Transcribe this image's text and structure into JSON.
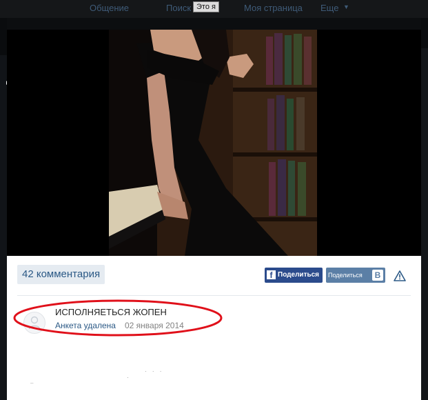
{
  "topnav": {
    "items": [
      "",
      "Общение",
      "Поиск",
      "Моя страница",
      "Еще"
    ],
    "tooltip": "Это я"
  },
  "viewer": {
    "photo_alt": "Фото"
  },
  "panel": {
    "comments_count": "42 комментария",
    "share_fb_label": "Поделиться",
    "share_vk_label": "Поделиться",
    "share_vk_letter": "B"
  },
  "comment": {
    "text": "ИСПОЛНЯЕТЬСЯ ЖОПЕН",
    "author": "Анкета удалена",
    "date": "02 января 2014"
  },
  "colors": {
    "link": "#2a5885",
    "annotation": "#e0101a",
    "fb": "#2b4b8c",
    "vk": "#5b7fa6"
  }
}
